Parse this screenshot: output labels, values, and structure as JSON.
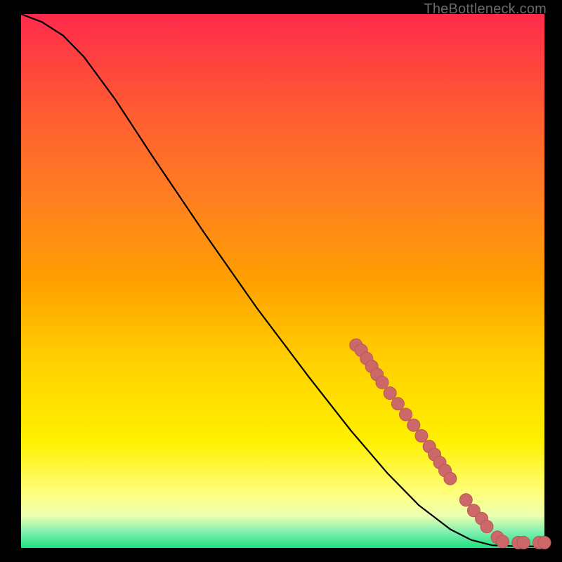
{
  "attribution": "TheBottleneck.com",
  "colors": {
    "background": "#000000",
    "gradient_stops": [
      "#ff2a4c",
      "#ff4040",
      "#ff6030",
      "#ff8020",
      "#ffa000",
      "#ffd000",
      "#fff000",
      "#ffff80",
      "#eaffb0",
      "#80f0b0",
      "#20e080"
    ],
    "curve": "#000000",
    "marker_fill": "#cd6868",
    "marker_stroke": "#b95858"
  },
  "chart_data": {
    "type": "line",
    "xlim": [
      0,
      100
    ],
    "ylim": [
      0,
      100
    ],
    "xlabel": "",
    "ylabel": "",
    "title": "",
    "curve": [
      {
        "x": 0,
        "y": 100
      },
      {
        "x": 4,
        "y": 98.5
      },
      {
        "x": 8,
        "y": 96
      },
      {
        "x": 12,
        "y": 92
      },
      {
        "x": 18,
        "y": 84
      },
      {
        "x": 25,
        "y": 73.5
      },
      {
        "x": 35,
        "y": 59
      },
      {
        "x": 45,
        "y": 45
      },
      {
        "x": 55,
        "y": 32
      },
      {
        "x": 63,
        "y": 22
      },
      {
        "x": 70,
        "y": 14
      },
      {
        "x": 76,
        "y": 8
      },
      {
        "x": 82,
        "y": 3.5
      },
      {
        "x": 86,
        "y": 1.5
      },
      {
        "x": 90,
        "y": 0.5
      },
      {
        "x": 95,
        "y": 0.3
      },
      {
        "x": 100,
        "y": 0.3
      }
    ],
    "markers": [
      {
        "x": 64,
        "y": 38
      },
      {
        "x": 65,
        "y": 37
      },
      {
        "x": 66,
        "y": 35.5
      },
      {
        "x": 67,
        "y": 34
      },
      {
        "x": 68,
        "y": 32.5
      },
      {
        "x": 69,
        "y": 31
      },
      {
        "x": 70.5,
        "y": 29
      },
      {
        "x": 72,
        "y": 27
      },
      {
        "x": 73.5,
        "y": 25
      },
      {
        "x": 75,
        "y": 23
      },
      {
        "x": 76.5,
        "y": 21
      },
      {
        "x": 78,
        "y": 19
      },
      {
        "x": 79,
        "y": 17.5
      },
      {
        "x": 80,
        "y": 16
      },
      {
        "x": 81,
        "y": 14.5
      },
      {
        "x": 82,
        "y": 13
      },
      {
        "x": 85,
        "y": 9
      },
      {
        "x": 86.5,
        "y": 7
      },
      {
        "x": 88,
        "y": 5.5
      },
      {
        "x": 89,
        "y": 4
      },
      {
        "x": 91,
        "y": 2
      },
      {
        "x": 92,
        "y": 1.2
      },
      {
        "x": 95,
        "y": 1
      },
      {
        "x": 96,
        "y": 1
      },
      {
        "x": 99,
        "y": 1
      },
      {
        "x": 100,
        "y": 1
      }
    ]
  }
}
